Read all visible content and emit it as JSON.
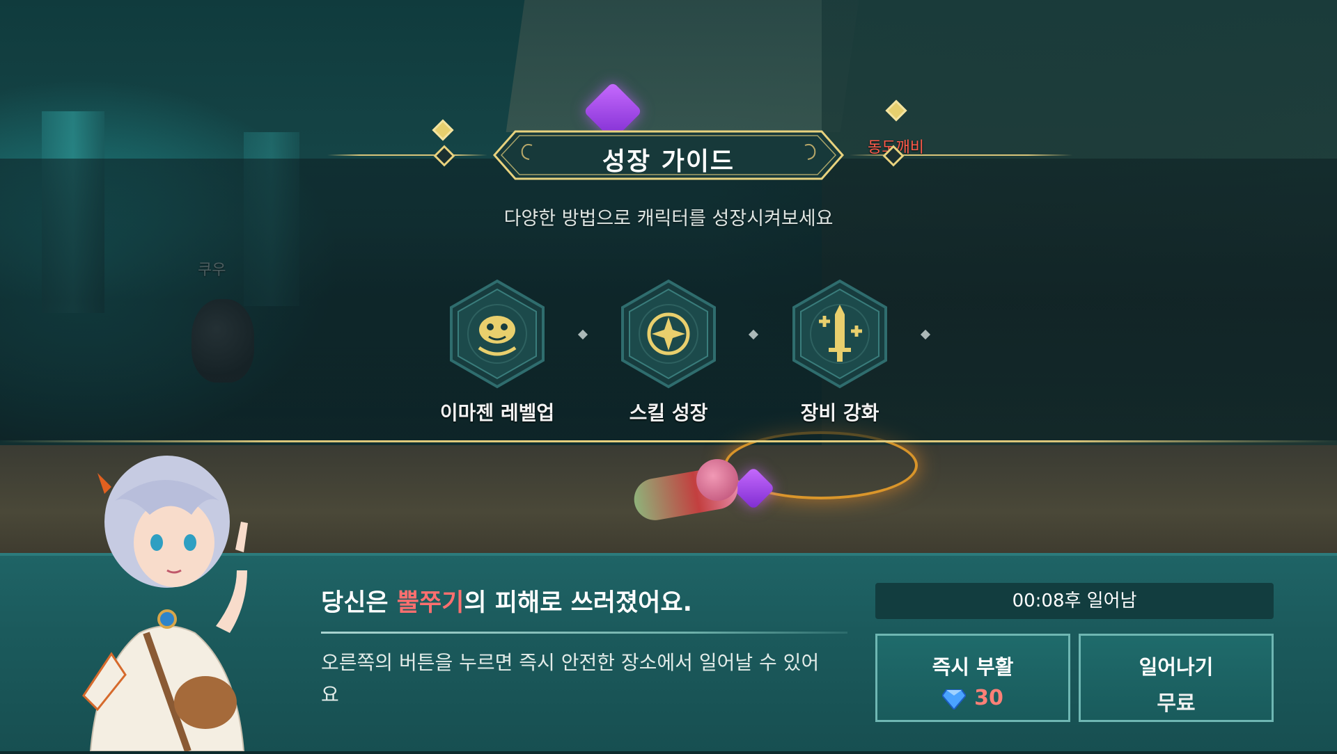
{
  "world": {
    "npc_name": "쿠우",
    "enemy_name": "동도깨비"
  },
  "guide": {
    "title": "성장 가이드",
    "subtitle": "다양한 방법으로 캐릭터를 성장시켜보세요",
    "items": [
      {
        "label": "이마젠 레벨업",
        "icon": "imagen-face-icon"
      },
      {
        "label": "스킬 성장",
        "icon": "skill-compass-icon"
      },
      {
        "label": "장비 강화",
        "icon": "sword-upgrade-icon"
      }
    ]
  },
  "death": {
    "prefix": "당신은 ",
    "attacker": "뿔쭈기",
    "suffix": "의 피해로 쓰러졌어요.",
    "body": "오른쪽의 버튼을 누르면 즉시 안전한 장소에서 일어날 수 있어요",
    "timer": "00:08후 일어남",
    "revive_label": "즉시 부활",
    "revive_cost": "30",
    "getup_label": "일어나기",
    "getup_cost": "무료"
  },
  "colors": {
    "accent_gold": "#e8d27e",
    "attacker_red": "#ff6f6f",
    "panel_teal": "#1b5a5c"
  }
}
